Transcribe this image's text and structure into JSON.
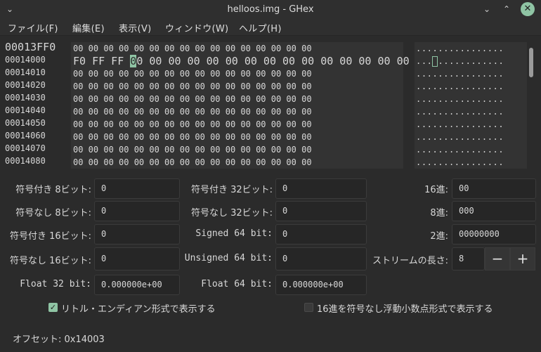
{
  "window": {
    "title": "helloos.img - GHex",
    "chevron_icon": "chevron-down-icon",
    "minimize_icon": "minimize-icon",
    "maximize_icon": "maximize-icon",
    "close_icon": "close-icon"
  },
  "menu": [
    "ファイル(F)",
    "編集(E)",
    "表示(V)",
    "ウィンドウ(W)",
    "ヘルプ(H)"
  ],
  "hex": {
    "addresses": [
      "00013FF0",
      "00014000",
      "00014010",
      "00014020",
      "00014030",
      "00014040",
      "00014050",
      "00014060",
      "00014070",
      "00014080"
    ],
    "row0": "00 00 00 00 00 00 00 00 00 00 00 00 00 00 00 00",
    "row1_before": "F0 FF FF ",
    "row1_cursor": "0",
    "row1_after": "0 00 00 00 00 00 00 00 00 00 00 00 00 00 00",
    "rows_rest": [
      "00 00 00 00 00 00 00 00 00 00 00 00 00 00 00 00",
      "00 00 00 00 00 00 00 00 00 00 00 00 00 00 00 00",
      "00 00 00 00 00 00 00 00 00 00 00 00 00 00 00 00",
      "00 00 00 00 00 00 00 00 00 00 00 00 00 00 00 00",
      "00 00 00 00 00 00 00 00 00 00 00 00 00 00 00 00",
      "00 00 00 00 00 00 00 00 00 00 00 00 00 00 00 00",
      "00 00 00 00 00 00 00 00 00 00 00 00 00 00 00 00",
      "00 00 00 00 00 00 00 00 00 00 00 00 00 00 00 00"
    ],
    "ascii_row0": "................",
    "ascii_row1_before": "...",
    "ascii_row1_after": "............",
    "ascii_rows_rest": [
      "................",
      "................",
      "................",
      "................",
      "................",
      "................",
      "................",
      "................"
    ]
  },
  "converter": {
    "signed8_label": "符号付き 8ビット:",
    "signed8_value": "0",
    "unsigned8_label": "符号なし 8ビット:",
    "unsigned8_value": "0",
    "signed16_label": "符号付き 16ビット:",
    "signed16_value": "0",
    "unsigned16_label": "符号なし 16ビット:",
    "unsigned16_value": "0",
    "float32_label": "Float 32 bit:",
    "float32_value": "0.000000e+00",
    "signed32_label": "符号付き 32ビット:",
    "signed32_value": "0",
    "unsigned32_label": "符号なし 32ビット:",
    "unsigned32_value": "0",
    "signed64_label": "Signed 64 bit:",
    "signed64_value": "0",
    "unsigned64_label": "Unsigned 64 bit:",
    "unsigned64_value": "0",
    "float64_label": "Float 64 bit:",
    "float64_value": "0.000000e+00",
    "hex_label": "16進:",
    "hex_value": "00",
    "oct_label": "8進:",
    "oct_value": "000",
    "bin_label": "2進:",
    "bin_value": "00000000",
    "stream_label": "ストリームの長さ:",
    "stream_value": "8",
    "minus": "−",
    "plus": "+",
    "little_endian_label": "リトル・エンディアン形式で表示する",
    "little_endian_checked": true,
    "unsigned_hex_label": "16進を符号なし浮動小数点形式で表示する",
    "unsigned_hex_checked": false
  },
  "status": {
    "offset": "オフセット: 0x14003"
  }
}
